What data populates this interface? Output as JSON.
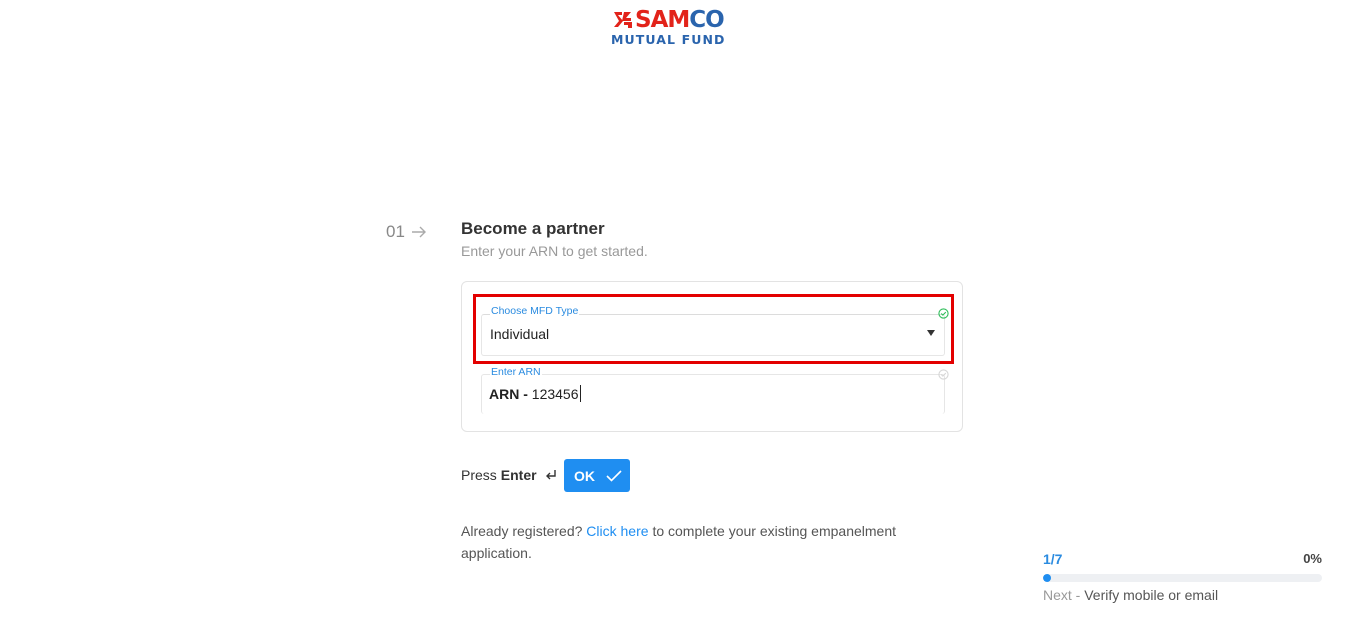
{
  "logo": {
    "brand_red": "SAM",
    "brand_blue": "CO",
    "subtitle": "MUTUAL FUND",
    "colors": {
      "red": "#e2231a",
      "blue": "#2a64ad"
    }
  },
  "step": {
    "number": "01",
    "arrow_icon": "arrow-right-icon",
    "title": "Become a partner",
    "subtitle": "Enter your ARN to get started."
  },
  "form": {
    "mfd_type": {
      "label": "Choose MFD Type",
      "value": "Individual",
      "status_icon": "check-circle-icon",
      "status": "valid"
    },
    "arn": {
      "label": "Enter ARN",
      "prefix": "ARN -",
      "value": "123456",
      "status_icon": "check-circle-icon",
      "status": "pending"
    }
  },
  "actions": {
    "press_text": "Press",
    "enter_text": "Enter",
    "enter_icon": "enter-return-icon",
    "ok_label": "OK",
    "ok_icon": "checkmark-icon",
    "accent": "#1f8ef1"
  },
  "already": {
    "prefix": "Already registered?",
    "link": "Click here",
    "suffix": "to complete your existing empanelment application."
  },
  "progress": {
    "count": "1/7",
    "percent_label": "0%",
    "percent": 0,
    "next_label": "Next -",
    "next_text": "Verify mobile or email"
  }
}
